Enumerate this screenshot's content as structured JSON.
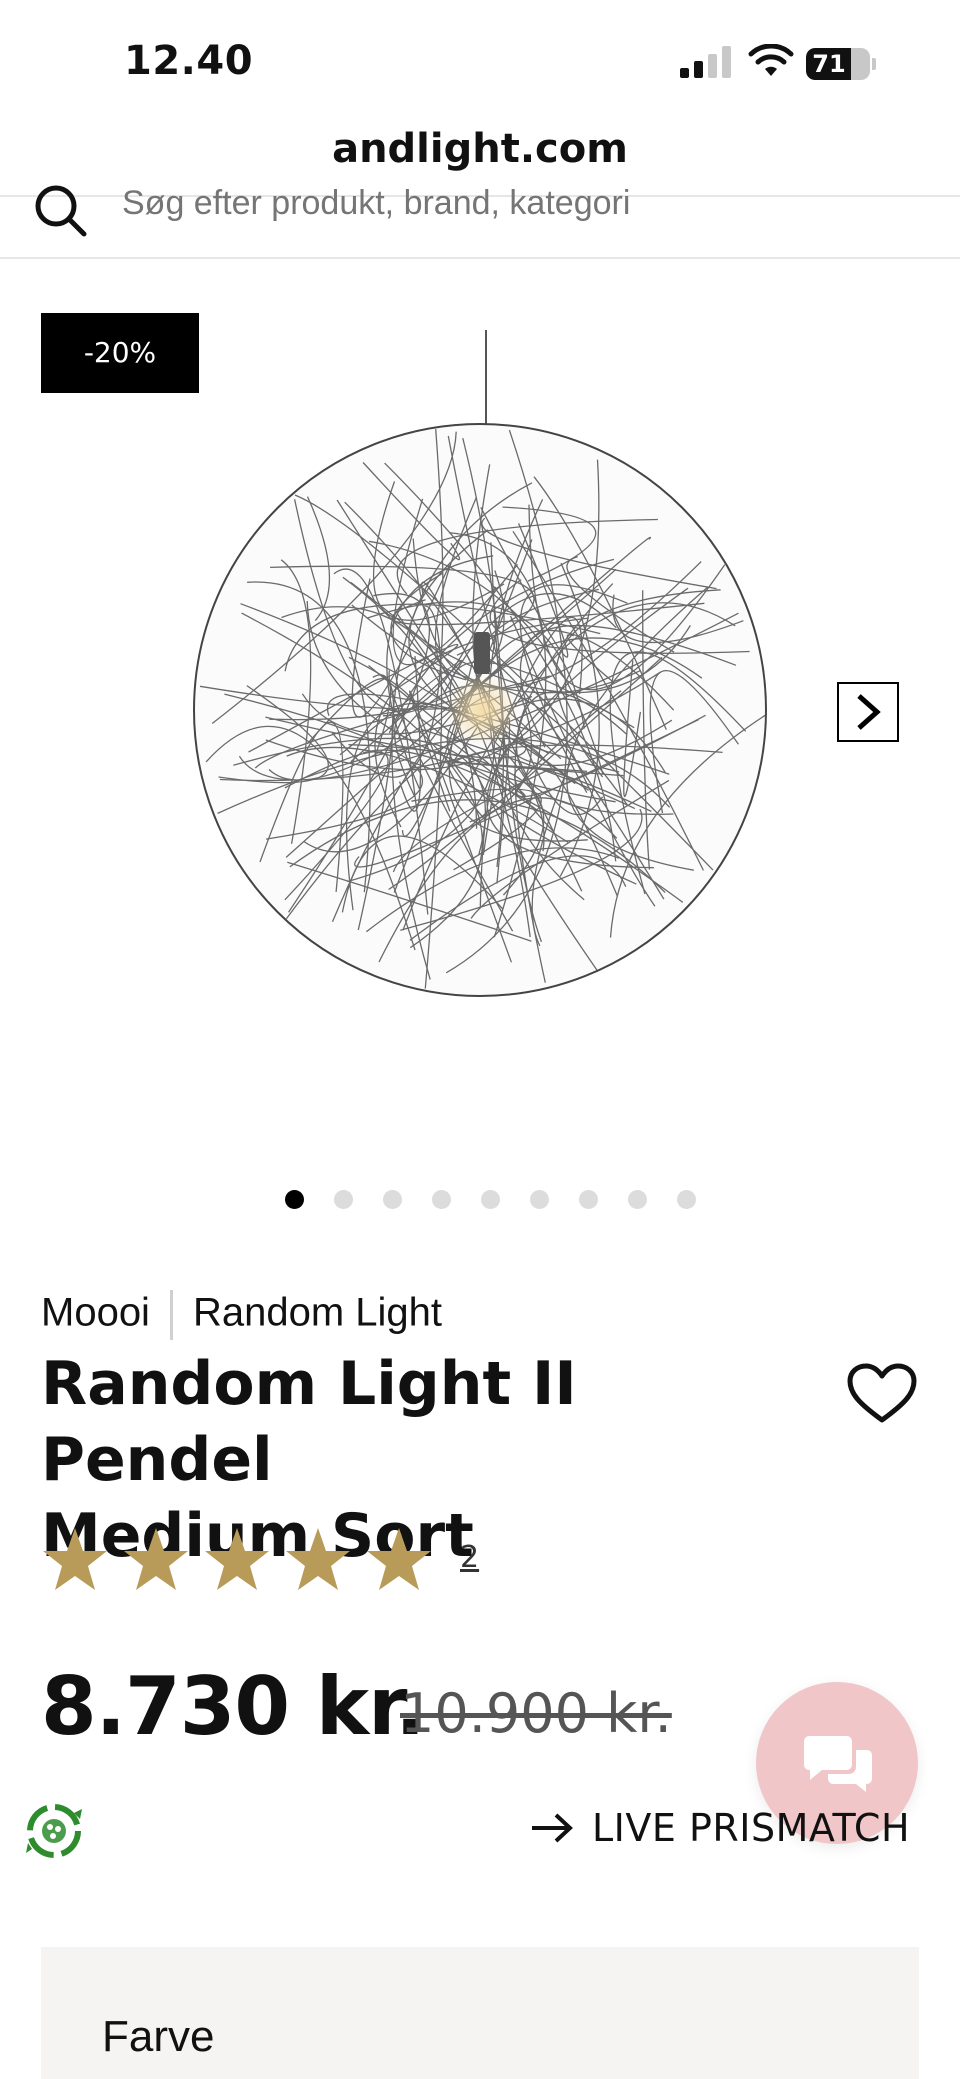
{
  "status_bar": {
    "time": "12.40",
    "battery_percent": "71",
    "battery_level": 0.71
  },
  "browser": {
    "url": "andlight.com"
  },
  "search": {
    "placeholder": "Søg efter produkt, brand, kategori"
  },
  "product": {
    "discount_badge": "-20%",
    "gallery": {
      "total_images": 9,
      "active_index": 0
    },
    "brand": "Moooi",
    "collection": "Random Light",
    "title_line1": "Random Light II Pendel",
    "title_line2": "Medium Sort",
    "rating": {
      "stars": 5,
      "max": 5,
      "count": "2",
      "star_color": "#b89b58"
    },
    "price": "8.730 kr.",
    "old_price": "10.900 kr."
  },
  "actions": {
    "price_match": "LIVE PRISMATCH"
  },
  "options": {
    "color_label": "Farve"
  },
  "colors": {
    "chat_bg": "#f0c6c8",
    "eco_green": "#2e8b2e",
    "panel_bg": "#f5f4f2"
  },
  "icons": [
    "search-icon",
    "chevron-right-icon",
    "heart-icon",
    "star-icon",
    "chat-icon",
    "eco-icon",
    "arrow-right-icon",
    "signal-icon",
    "wifi-icon",
    "battery-icon"
  ]
}
